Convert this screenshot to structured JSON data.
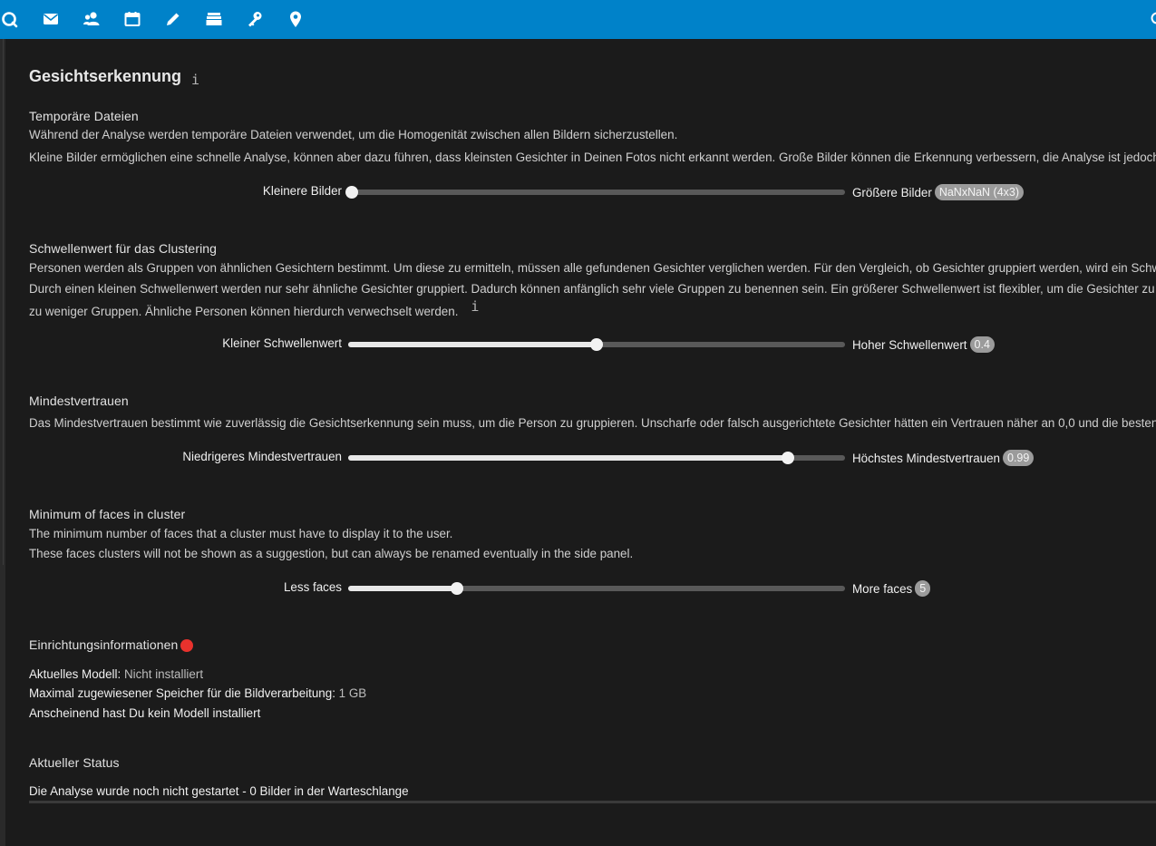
{
  "app": {
    "nav_icons": [
      "dashboard-icon",
      "mail-icon",
      "contacts-icon",
      "calendar-icon",
      "notes-icon",
      "files-icon",
      "passwords-icon",
      "maps-icon"
    ],
    "accent_color": "#0082c9"
  },
  "page": {
    "title": "Gesichtserkennung",
    "info_glyph": "i"
  },
  "temp_files": {
    "title": "Temporäre Dateien",
    "desc1": "Während der Analyse werden temporäre Dateien verwendet, um die Homogenität zwischen allen Bildern sicherzustellen.",
    "desc2": "Kleine Bilder ermöglichen eine schnelle Analyse, können aber dazu führen, dass kleinsten Gesichter in Deinen Fotos nicht erkannt werden. Große Bilder können die Erkennung verbessern, die Analyse ist jedoch l",
    "slider_left": "Kleinere Bilder",
    "slider_right": "Größere Bilder",
    "value": "NaNxNaN (4x3)",
    "fraction": 0.0
  },
  "threshold": {
    "title": "Schwellenwert für das Clustering",
    "desc1": "Personen werden als Gruppen von ähnlichen Gesichtern bestimmt. Um diese zu ermitteln, müssen alle gefundenen Gesichter verglichen werden. Für den Vergleich, ob Gesichter gruppiert werden, wird ein Schwe",
    "desc2": "Durch einen kleinen Schwellenwert werden nur sehr ähnliche Gesichter gruppiert. Dadurch können anfänglich sehr viele Gruppen zu benennen sein. Ein größerer Schwellenwert ist flexibler, um die Gesichter zu g",
    "desc3": "zu weniger Gruppen. Ähnliche Personen können hierdurch verwechselt werden.",
    "info_glyph": "i",
    "slider_left": "Kleiner Schwellenwert",
    "slider_right": "Hoher Schwellenwert",
    "value": "0.4",
    "fraction": 0.5
  },
  "confidence": {
    "title": "Mindestvertrauen",
    "desc1": "Das Mindestvertrauen bestimmt wie zuverlässig die Gesichtserkennung sein muss, um die Person zu gruppieren. Unscharfe oder falsch ausgerichtete Gesichter hätten ein Vertrauen näher an 0,0 und die besten E",
    "slider_left": "Niedrigeres Mindestvertrauen",
    "slider_right": "Höchstes Mindestvertrauen",
    "value": "0.99",
    "fraction": 0.89
  },
  "min_faces": {
    "title": "Minimum of faces in cluster",
    "desc1": "The minimum number of faces that a cluster must have to display it to the user.",
    "desc2": "These faces clusters will not be shown as a suggestion, but can always be renamed eventually in the side panel.",
    "slider_left": "Less faces",
    "slider_right": "More faces",
    "value": "5",
    "fraction": 0.215
  },
  "setup": {
    "title": "Einrichtungsinformationen",
    "status_color": "#e9322d",
    "model_label": "Aktuelles Modell:",
    "model_value": "Nicht installiert",
    "memory_label": "Maximal zugewiesener Speicher für die Bildverarbeitung:",
    "memory_value": "1 GB",
    "note": "Anscheinend hast Du kein Modell installiert"
  },
  "status": {
    "title": "Aktueller Status",
    "text": "Die Analyse wurde noch nicht gestartet - 0 Bilder in der Warteschlange"
  }
}
